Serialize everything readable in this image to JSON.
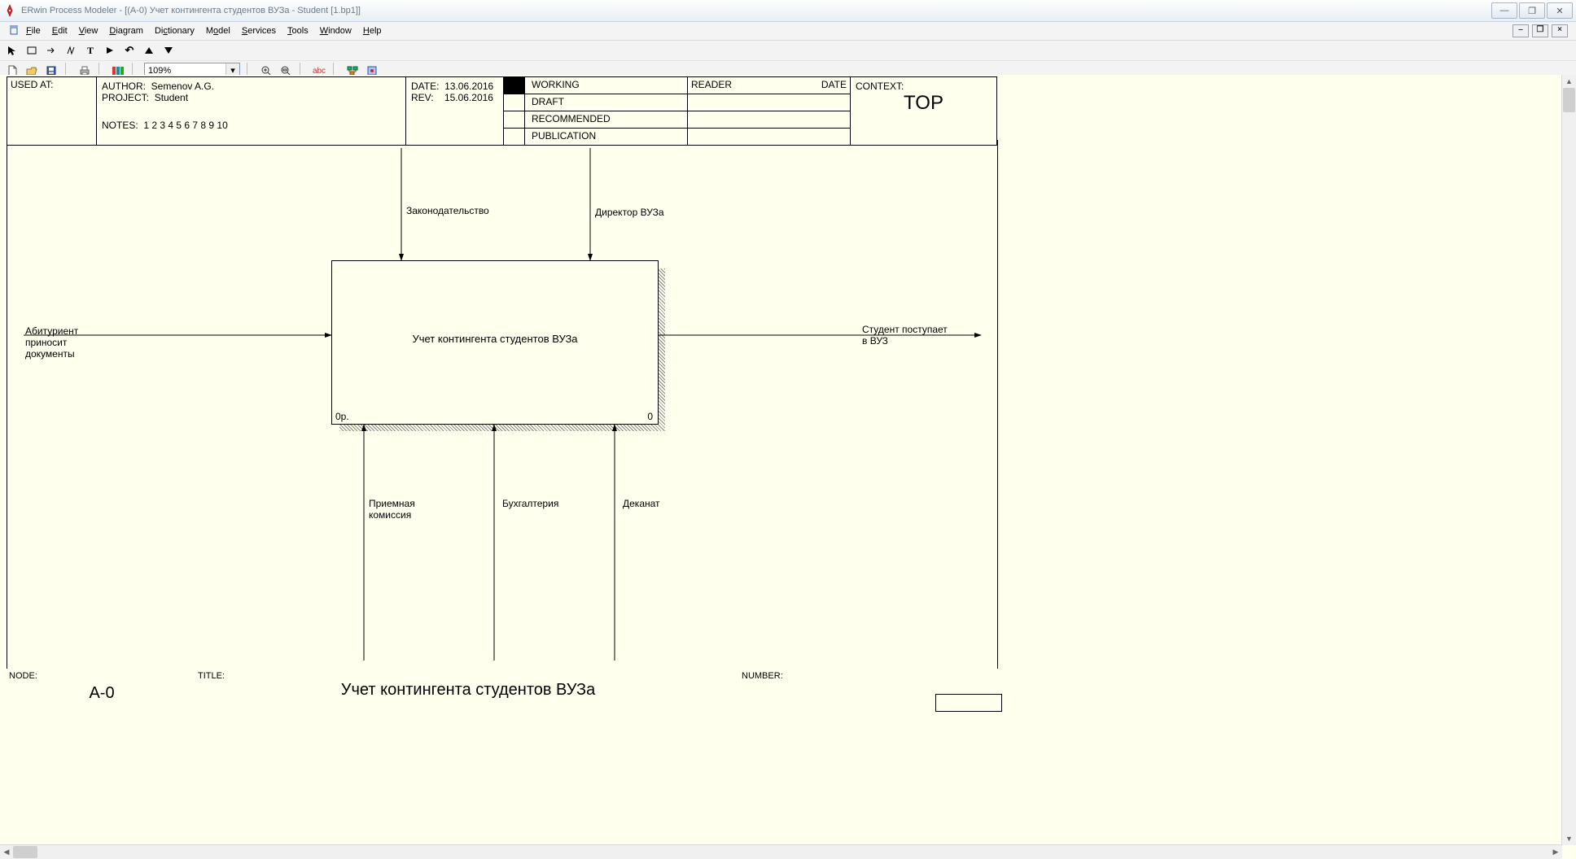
{
  "window": {
    "title": "ERwin Process Modeler - [(A-0) Учет контингента студентов ВУЗа - Student  [1.bp1]]"
  },
  "menu": {
    "file": "File",
    "edit": "Edit",
    "view": "View",
    "diagram": "Diagram",
    "dictionary": "Dictionary",
    "model": "Model",
    "services": "Services",
    "tools": "Tools",
    "window": "Window",
    "help": "Help"
  },
  "toolbar2": {
    "zoom": "109%"
  },
  "header": {
    "used_at_label": "USED AT:",
    "author_label": "AUTHOR:",
    "author": "Semenov A.G.",
    "project_label": "PROJECT:",
    "project": "Student",
    "notes_label": "NOTES:",
    "notes": "1  2  3  4  5  6  7  8  9  10",
    "date_label": "DATE:",
    "date": "13.06.2016",
    "rev_label": "REV:",
    "rev": "15.06.2016",
    "working": "WORKING",
    "draft": "DRAFT",
    "recommended": "RECOMMENDED",
    "publication": "PUBLICATION",
    "reader_label": "READER",
    "reader_date_label": "DATE",
    "context_label": "CONTEXT:",
    "context_value": "TOP"
  },
  "diagram": {
    "activity_title": "Учет контингента студентов ВУЗа",
    "activity_cost": "0р.",
    "activity_num": "0",
    "input1": "Абитуриент\nприносит\nдокументы",
    "control1": "Законодательство",
    "control2": "Директор ВУЗа",
    "output1": "Студент поступает\nв ВУЗ",
    "mech1": "Приемная\nкомиссия",
    "mech2": "Бухгалтерия",
    "mech3": "Деканат"
  },
  "footer": {
    "node_label": "NODE:",
    "node": "A-0",
    "title_label": "TITLE:",
    "title": "Учет контингента студентов ВУЗа",
    "number_label": "NUMBER:"
  }
}
